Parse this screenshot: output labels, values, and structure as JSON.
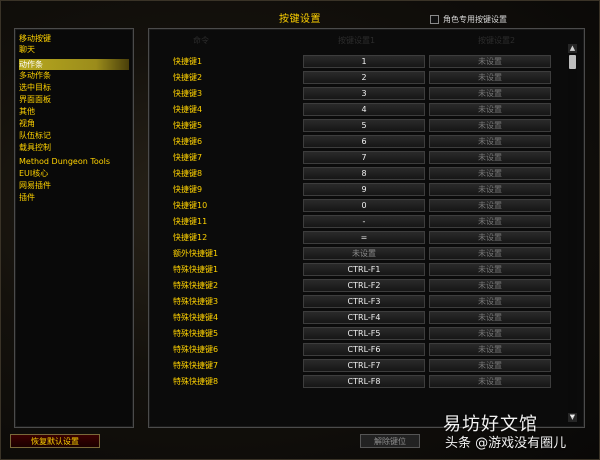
{
  "window": {
    "title": "按键设置",
    "char_specific_label": "角色专用按键设置"
  },
  "sidebar": {
    "items": [
      {
        "label": "移动按键"
      },
      {
        "label": "聊天"
      },
      {
        "label": "动作条"
      },
      {
        "label": "多动作条"
      },
      {
        "label": "选中目标"
      },
      {
        "label": "界面面板"
      },
      {
        "label": "其他"
      },
      {
        "label": "视角"
      },
      {
        "label": "队伍标记"
      },
      {
        "label": "载具控制"
      },
      {
        "label": "Method Dungeon Tools"
      },
      {
        "label": "EUI核心"
      },
      {
        "label": "网易插件"
      },
      {
        "label": "插件"
      }
    ],
    "selected_index": 2
  },
  "columns": {
    "action": "命令",
    "key1": "按键设置1",
    "key2": "按键设置2"
  },
  "rows": [
    {
      "label": "快捷键1",
      "key1": "1",
      "key2": "未设置"
    },
    {
      "label": "快捷键2",
      "key1": "2",
      "key2": "未设置"
    },
    {
      "label": "快捷键3",
      "key1": "3",
      "key2": "未设置"
    },
    {
      "label": "快捷键4",
      "key1": "4",
      "key2": "未设置"
    },
    {
      "label": "快捷键5",
      "key1": "5",
      "key2": "未设置"
    },
    {
      "label": "快捷键6",
      "key1": "6",
      "key2": "未设置"
    },
    {
      "label": "快捷键7",
      "key1": "7",
      "key2": "未设置"
    },
    {
      "label": "快捷键8",
      "key1": "8",
      "key2": "未设置"
    },
    {
      "label": "快捷键9",
      "key1": "9",
      "key2": "未设置"
    },
    {
      "label": "快捷键10",
      "key1": "0",
      "key2": "未设置"
    },
    {
      "label": "快捷键11",
      "key1": "-",
      "key2": "未设置"
    },
    {
      "label": "快捷键12",
      "key1": "=",
      "key2": "未设置"
    },
    {
      "label": "额外快捷键1",
      "key1": "未设置",
      "key2": "未设置"
    },
    {
      "label": "特殊快捷键1",
      "key1": "CTRL-F1",
      "key2": "未设置"
    },
    {
      "label": "特殊快捷键2",
      "key1": "CTRL-F2",
      "key2": "未设置"
    },
    {
      "label": "特殊快捷键3",
      "key1": "CTRL-F3",
      "key2": "未设置"
    },
    {
      "label": "特殊快捷键4",
      "key1": "CTRL-F4",
      "key2": "未设置"
    },
    {
      "label": "特殊快捷键5",
      "key1": "CTRL-F5",
      "key2": "未设置"
    },
    {
      "label": "特殊快捷键6",
      "key1": "CTRL-F6",
      "key2": "未设置"
    },
    {
      "label": "特殊快捷键7",
      "key1": "CTRL-F7",
      "key2": "未设置"
    },
    {
      "label": "特殊快捷键8",
      "key1": "CTRL-F8",
      "key2": "未设置"
    }
  ],
  "footer": {
    "reset_label": "恢复默认设置",
    "unbind_label": "解除键位"
  },
  "watermark": {
    "line1": "易坊好文馆",
    "line2": "头条 @游戏没有圈儿"
  },
  "icons": {
    "scroll_up": "scroll-up-icon",
    "scroll_down": "scroll-down-icon"
  },
  "colors": {
    "label_gold": "#ffd200",
    "selected_bg": "#b7a81e",
    "button_border": "#7a6a3a"
  }
}
